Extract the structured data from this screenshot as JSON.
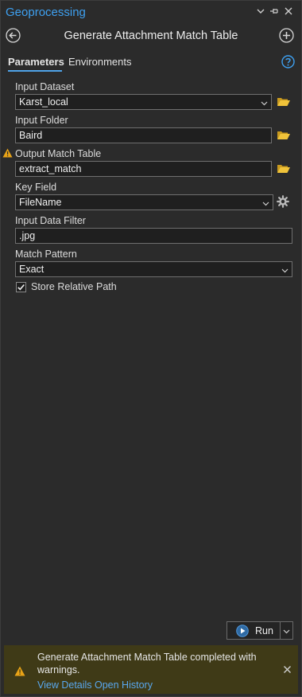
{
  "titlebar": {
    "title": "Geoprocessing",
    "icons": [
      "chevron-down-icon",
      "pin-icon",
      "close-icon"
    ]
  },
  "header": {
    "tool_title": "Generate Attachment Match Table",
    "back_icon": "back-arrow-icon",
    "add_icon": "add-icon"
  },
  "tabs": [
    {
      "label": "Parameters",
      "active": true
    },
    {
      "label": "Environments",
      "active": false
    }
  ],
  "help_icon": "help-icon",
  "params": {
    "input_dataset": {
      "label": "Input Dataset",
      "value": "Karst_local"
    },
    "input_folder": {
      "label": "Input Folder",
      "value": "Baird"
    },
    "output_match_table": {
      "label": "Output Match Table",
      "value": "extract_match",
      "warning": true
    },
    "key_field": {
      "label": "Key Field",
      "value": "FileName"
    },
    "input_data_filter": {
      "label": "Input Data Filter",
      "value": ".jpg"
    },
    "match_pattern": {
      "label": "Match Pattern",
      "value": "Exact"
    },
    "store_relative_path": {
      "label": "Store Relative Path",
      "checked": true
    }
  },
  "run": {
    "label": "Run"
  },
  "notification": {
    "message": "Generate Attachment Match Table completed with warnings.",
    "view_details": "View Details",
    "open_history": "Open History"
  },
  "colors": {
    "accent": "#3ea0f0",
    "warning": "#e8a317",
    "notice_bg": "#3f3a17",
    "folder": "#f0c33a"
  }
}
